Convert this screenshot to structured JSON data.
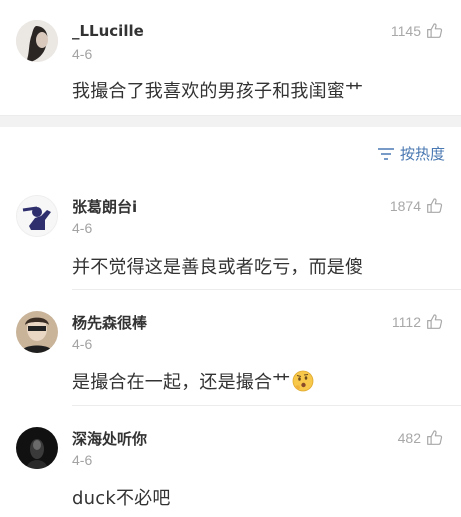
{
  "comments": [
    {
      "username": "_LLucille",
      "date": "4-6",
      "likes": "1145",
      "text": "我撮合了我喜欢的男孩子和我闺蜜艹"
    },
    {
      "username": "张葛朗台i",
      "date": "4-6",
      "likes": "1874",
      "text": "并不觉得这是善良或者吃亏，而是傻"
    },
    {
      "username": "杨先森很棒",
      "date": "4-6",
      "likes": "1112",
      "text": "是撮合在一起，还是撮合艹"
    },
    {
      "username": "深海处听你",
      "date": "4-6",
      "likes": "482",
      "text": "duck不必吧"
    }
  ],
  "sort": {
    "label": "按热度",
    "icon": "sort-lines-icon"
  },
  "colors": {
    "accent": "#4a78b2",
    "meta": "#a3a3a3",
    "separator": "#f2f2f2"
  }
}
